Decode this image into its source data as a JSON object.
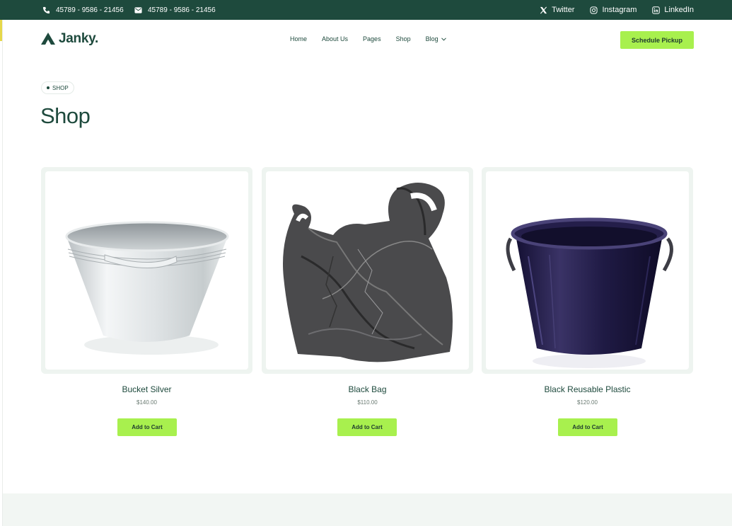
{
  "topbar": {
    "phone": "45789 - 9586 - 21456",
    "email": "45789 - 9586 - 21456",
    "social": [
      {
        "label": "Twitter",
        "icon": "x-icon"
      },
      {
        "label": "Instagram",
        "icon": "instagram-icon"
      },
      {
        "label": "LinkedIn",
        "icon": "linkedin-icon"
      }
    ]
  },
  "header": {
    "brand": "Janky.",
    "nav": [
      "Home",
      "About Us",
      "Pages",
      "Shop",
      "Blog"
    ],
    "cta": "Schedule Pickup"
  },
  "breadcrumb": "SHOP",
  "page_title": "Shop",
  "products": [
    {
      "name": "Bucket Silver",
      "price": "$140.00",
      "button": "Add to Cart"
    },
    {
      "name": "Black Bag",
      "price": "$110.00",
      "button": "Add to Cart"
    },
    {
      "name": "Black Reusable Plastic",
      "price": "$120.00",
      "button": "Add to Cart"
    }
  ],
  "colors": {
    "topbar_bg": "#1e4a3d",
    "brand_green": "#1e4a3d",
    "accent_lime": "#a8f04e",
    "card_bg": "#eef4f0"
  }
}
